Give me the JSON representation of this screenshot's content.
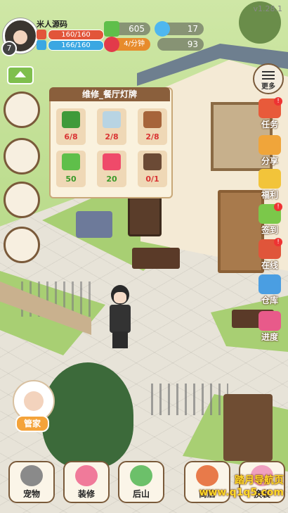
{
  "version": "v1.28.1",
  "player": {
    "name": "米人源码",
    "level": "7",
    "hp_text": "160/160",
    "hp_fill": 1.0,
    "mp_text": "166/160",
    "mp_fill": 1.0,
    "hp_color": "#e2553a",
    "mp_color": "#3aa7e2"
  },
  "resources": {
    "cash": "605",
    "diamond": "17",
    "energy_rate": "4/分钟",
    "energy": "93"
  },
  "repair_panel": {
    "title": "维修_餐厅灯牌",
    "items": [
      {
        "icon": "scallion-icon",
        "count": "6/8",
        "status": "short"
      },
      {
        "icon": "stone-icon",
        "count": "2/8",
        "status": "short"
      },
      {
        "icon": "wood-log-icon",
        "count": "2/8",
        "status": "short"
      },
      {
        "icon": "cash-icon",
        "count": "50",
        "status": "ok"
      },
      {
        "icon": "heart-icon",
        "count": "20",
        "status": "ok"
      },
      {
        "icon": "sign-board-icon",
        "count": "0/1",
        "status": "short"
      }
    ]
  },
  "right_menu": {
    "more": "更多",
    "items": [
      {
        "label": "任务",
        "icon": "task-icon",
        "badge": "!"
      },
      {
        "label": "分享",
        "icon": "share-icon",
        "badge": ""
      },
      {
        "label": "福利",
        "icon": "gift-icon",
        "badge": ""
      },
      {
        "label": "签到",
        "icon": "signin-icon",
        "badge": "!"
      },
      {
        "label": "在线",
        "icon": "online-clock-icon",
        "badge": "!"
      },
      {
        "label": "仓库",
        "icon": "warehouse-icon",
        "badge": ""
      },
      {
        "label": "进度",
        "icon": "progress-icon",
        "badge": ""
      }
    ]
  },
  "butler": {
    "label": "管家"
  },
  "bottom_bar": [
    {
      "label": "宠物",
      "icon": "cat-icon"
    },
    {
      "label": "装修",
      "icon": "paint-brush-icon"
    },
    {
      "label": "后山",
      "icon": "mountain-icon"
    },
    {
      "label": "商店",
      "icon": "shop-icon"
    },
    {
      "label": "换装",
      "icon": "dress-icon"
    }
  ],
  "watermark": {
    "line1": "踏月导航页",
    "line2": "www.q1q5.com"
  }
}
